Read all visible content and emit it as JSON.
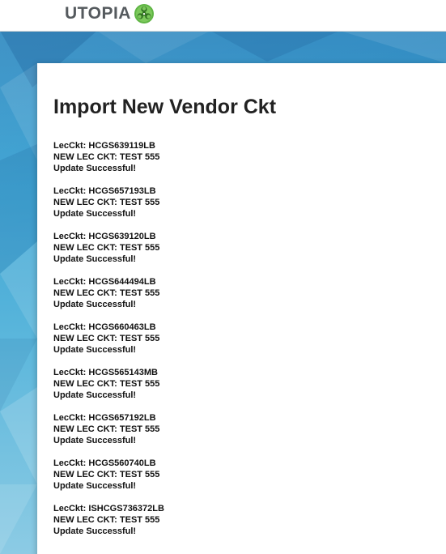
{
  "header": {
    "logo_text": "UTOPIA",
    "logo_icon": "biohazard-icon"
  },
  "colors": {
    "background_blue": "#2f93c8",
    "logo_green": "#5fb544",
    "logo_text_gray": "#555a5e",
    "panel_white": "#ffffff"
  },
  "page": {
    "title": "Import New Vendor Ckt"
  },
  "results": [
    {
      "lec_ckt": "LecCkt: HCGS639119LB",
      "new_lec_ckt": "NEW LEC CKT: TEST 555",
      "status": "Update Successful!"
    },
    {
      "lec_ckt": "LecCkt: HCGS657193LB",
      "new_lec_ckt": "NEW LEC CKT: TEST 555",
      "status": "Update Successful!"
    },
    {
      "lec_ckt": "LecCkt: HCGS639120LB",
      "new_lec_ckt": "NEW LEC CKT: TEST 555",
      "status": "Update Successful!"
    },
    {
      "lec_ckt": "LecCkt: HCGS644494LB",
      "new_lec_ckt": "NEW LEC CKT: TEST 555",
      "status": "Update Successful!"
    },
    {
      "lec_ckt": "LecCkt: HCGS660463LB",
      "new_lec_ckt": "NEW LEC CKT: TEST 555",
      "status": "Update Successful!"
    },
    {
      "lec_ckt": "LecCkt: HCGS565143MB",
      "new_lec_ckt": "NEW LEC CKT: TEST 555",
      "status": "Update Successful!"
    },
    {
      "lec_ckt": "LecCkt: HCGS657192LB",
      "new_lec_ckt": "NEW LEC CKT: TEST 555",
      "status": "Update Successful!"
    },
    {
      "lec_ckt": "LecCkt: HCGS560740LB",
      "new_lec_ckt": "NEW LEC CKT: TEST 555",
      "status": "Update Successful!"
    },
    {
      "lec_ckt": "LecCkt: ISHCGS736372LB",
      "new_lec_ckt": "NEW LEC CKT: TEST 555",
      "status": "Update Successful!"
    }
  ]
}
